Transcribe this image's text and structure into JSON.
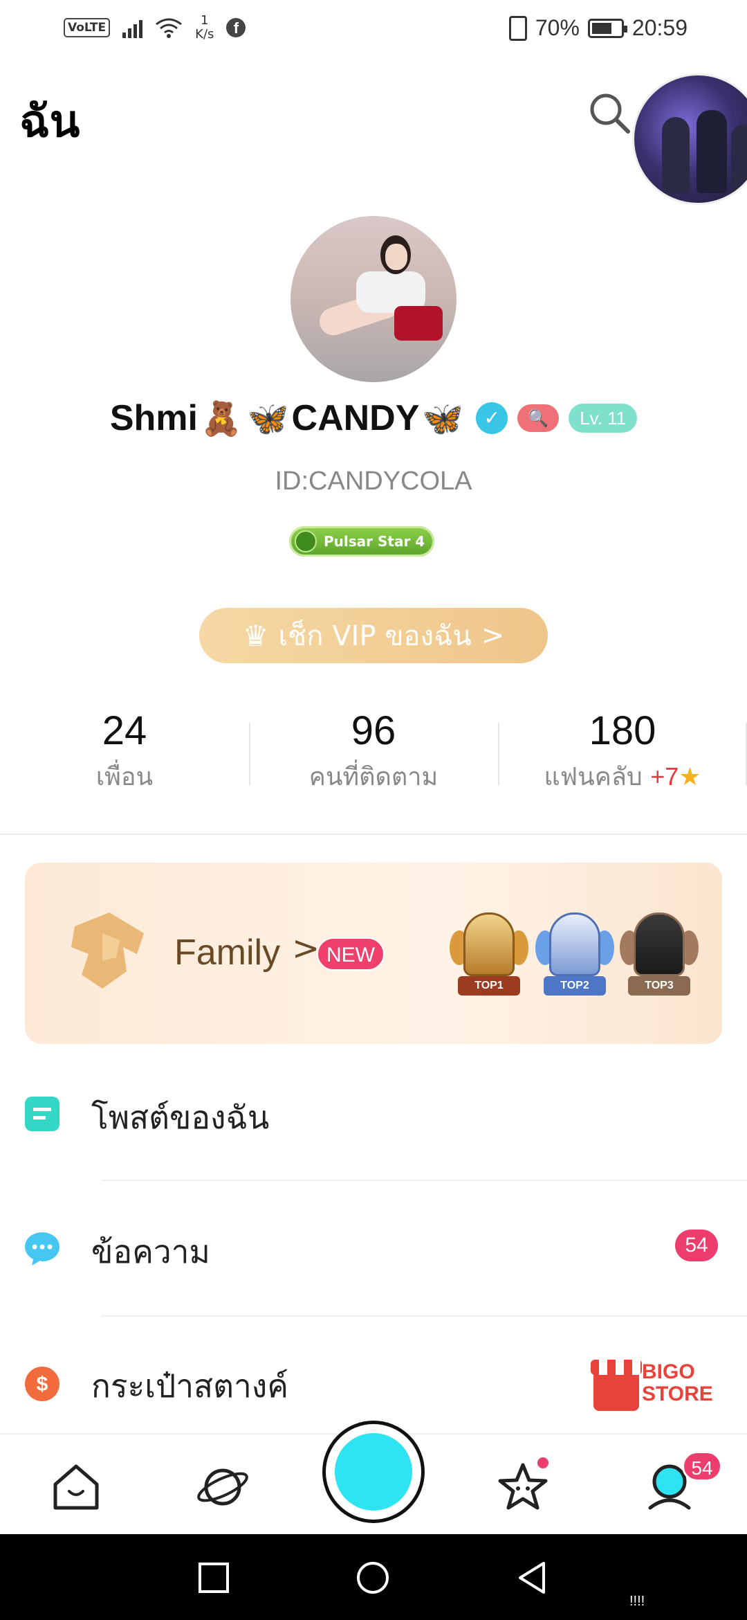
{
  "status_bar": {
    "volte": "VoLTE",
    "speed_value": "1",
    "speed_unit": "K/s",
    "battery": "70%",
    "time": "20:59",
    "icons": [
      "signal-icon",
      "wifi-icon",
      "facebook-icon",
      "vibrate-icon",
      "battery-icon"
    ],
    "battery_level": 0.7
  },
  "header": {
    "title": "ฉัน"
  },
  "profile": {
    "name_part1": "Shmi",
    "name_part2": "CANDY",
    "emoji_bear": "🧸",
    "emoji_butterfly": "🦋",
    "level": "Lv. 11",
    "user_id": "ID:CANDYCOLA",
    "pulsar_badge": "Pulsar Star 4",
    "vip_button": "เช็ก VIP ของฉัน",
    "vip_chevron": ">"
  },
  "stats": [
    {
      "value": "24",
      "label": "เพื่อน"
    },
    {
      "value": "96",
      "label": "คนที่ติดตาม"
    },
    {
      "value": "180",
      "label": "แฟนคลับ",
      "extra": "+7"
    }
  ],
  "family": {
    "label": "Family",
    "chevron": ">",
    "new_badge": "NEW",
    "medals": [
      "TOP1",
      "TOP2",
      "TOP3"
    ]
  },
  "menu": [
    {
      "label": "โพสต์ของฉัน",
      "icon": "post-icon"
    },
    {
      "label": "ข้อความ",
      "icon": "message-icon",
      "badge": "54"
    },
    {
      "label": "กระเป๋าสตางค์",
      "icon": "wallet-icon",
      "promo": "BIGO STORE",
      "promo_line1": "BIGO",
      "promo_line2": "STORE"
    }
  ],
  "bottom_nav": {
    "items": [
      "home-icon",
      "explore-icon",
      "live-button",
      "favorites-icon",
      "me-icon"
    ],
    "me_badge": "54"
  },
  "system_nav": {
    "extra": "!!!!"
  },
  "colors": {
    "accent": "#2fe4f2",
    "badge": "#ec3d6c",
    "vip": "#efc68a",
    "level": "#7fe0cb"
  }
}
